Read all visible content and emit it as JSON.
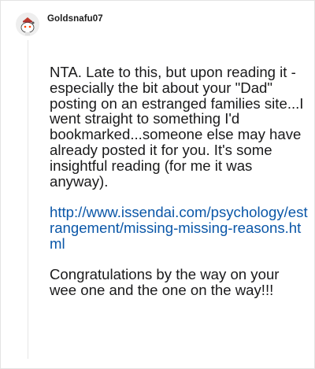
{
  "comment": {
    "username": "Goldsnafu07",
    "avatar_icon": "snoo-avatar-icon",
    "paragraphs": [
      "NTA. Late to this, but upon reading it - especially the bit about your \"Dad\" posting on an estranged families site...I went straight to something I'd bookmarked...someone else may have already posted it for you. It's some insightful reading (for me it was anyway).",
      "Congratulations by the way on your wee one and the one on the way!!!"
    ],
    "link": "http://www.issendai.com/psychology/estrangement/missing-missing-reasons.html"
  },
  "colors": {
    "link": "#0b57a8",
    "text": "#1a1a1b",
    "thread_line": "#e6e6e6"
  }
}
